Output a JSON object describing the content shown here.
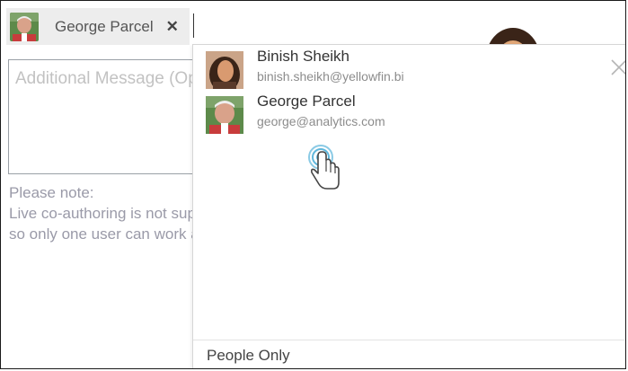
{
  "recipient_chip": {
    "name": "George Parcel",
    "remove_glyph": "✕",
    "avatar_icon": "george-avatar"
  },
  "message": {
    "placeholder": "Additional Message (Optional)"
  },
  "note": {
    "line1": "Please note:",
    "line2": "Live co-authoring is not supported,",
    "line3": "so only one user can work at a time."
  },
  "dropdown": {
    "options": [
      {
        "name": "Binish Sheikh",
        "email": "binish.sheikh@yellowfin.bi",
        "avatar_icon": "binish-avatar"
      },
      {
        "name": "George Parcel",
        "email": "george@analytics.com",
        "avatar_icon": "george-avatar"
      }
    ],
    "footer_label": "People Only",
    "close_icon": "close-icon"
  },
  "colors": {
    "chip_bg": "#ededed",
    "placeholder": "#c2c2c2",
    "note_text": "#9a9aa8",
    "pointer_ripple": "#2a9fd0"
  }
}
